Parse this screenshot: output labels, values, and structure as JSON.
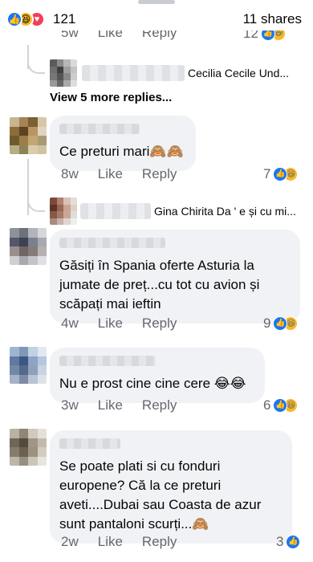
{
  "header": {
    "reaction_icons": [
      "like-icon",
      "haha-icon",
      "love-icon"
    ],
    "reaction_count": "121",
    "shares": "11 shares"
  },
  "top_partial": {
    "time": "5w",
    "like": "Like",
    "reply": "Reply",
    "count": "12"
  },
  "reply_previews": [
    {
      "text": "Cecilia Cecile Und..."
    },
    {
      "text": "Gina Chirita Da ' e și cu mi..."
    }
  ],
  "view_more": "View 5 more replies...",
  "comments": [
    {
      "text": "Ce preturi mari🙈🙈",
      "time": "8w",
      "like": "Like",
      "reply": "Reply",
      "count": "7",
      "reactions": [
        "like-icon",
        "haha-icon"
      ]
    },
    {
      "text": "Găsiți în Spania oferte Asturia la jumate de preț...cu tot cu avion și scăpați mai ieftin",
      "time": "4w",
      "like": "Like",
      "reply": "Reply",
      "count": "9",
      "reactions": [
        "like-icon",
        "haha-icon"
      ]
    },
    {
      "text": "Nu e prost cine cine cere 😂😂",
      "time": "3w",
      "like": "Like",
      "reply": "Reply",
      "count": "6",
      "reactions": [
        "like-icon",
        "haha-icon"
      ]
    },
    {
      "text": "Se poate plati si cu fonduri europene? Că la ce preturi aveti....Dubai sau Coasta de azur sunt pantaloni scurți...🙈",
      "time": "2w",
      "like": "Like",
      "reply": "Reply",
      "count": "3",
      "reactions": [
        "like-icon"
      ]
    }
  ],
  "colors": {
    "like_blue": "#1877f2",
    "haha_yellow": "#f7b928",
    "love_red": "#f33e58",
    "bubble_bg": "#f0f2f5",
    "meta_gray": "#65676b"
  }
}
